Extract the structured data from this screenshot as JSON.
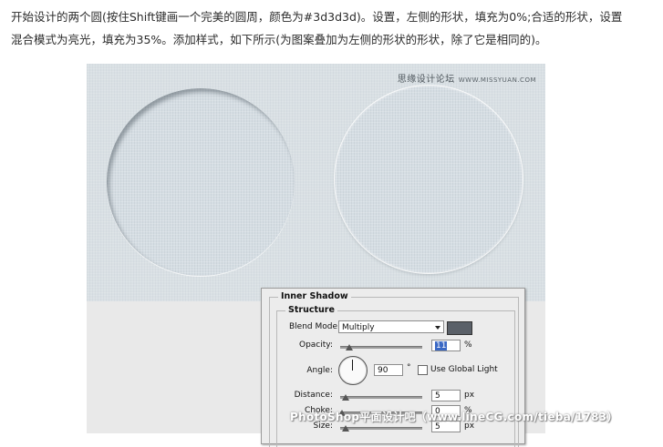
{
  "intro": {
    "line1": "开始设计的两个圆(按住Shift键画一个完美的圆周，颜色为#3d3d3d)。设置，左侧的形状，填充为0%;合适的形状，设置",
    "line2": "混合模式为亮光，填充为35%。添加样式，如下所示(为图案叠加为左侧的形状的形状，除了它是相同的)。"
  },
  "figure": {
    "watermark_top": "思缘设计论坛",
    "watermark_top_url": "WWW.MISSYUAN.COM"
  },
  "dialog": {
    "section_title": "Inner Shadow",
    "group_title": "Structure",
    "blend_mode_label": "Blend Mode:",
    "blend_mode_value": "Multiply",
    "shadow_color": "#5a6068",
    "opacity_label": "Opacity:",
    "opacity_value": "11",
    "opacity_unit": "%",
    "angle_label": "Angle:",
    "angle_value": "90",
    "angle_unit": "°",
    "use_global_light_label": "Use Global Light",
    "use_global_light_checked": false,
    "distance_label": "Distance:",
    "distance_value": "5",
    "distance_unit": "px",
    "choke_label": "Choke:",
    "choke_value": "0",
    "choke_unit": "%",
    "size_label": "Size:",
    "size_value": "5",
    "size_unit": "px"
  },
  "watermark_bottom": "PhotoShop平面设计吧（www.lineCG.com/tieba/1783）"
}
